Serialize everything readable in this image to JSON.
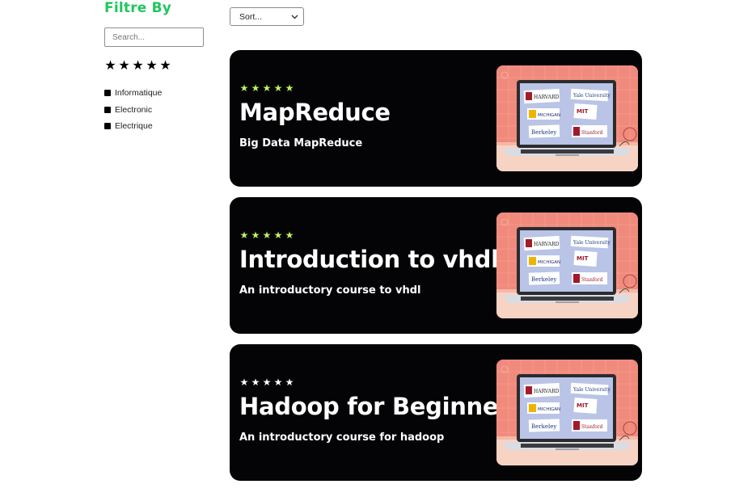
{
  "sidebar": {
    "title": "Filtre By",
    "search_placeholder": "Search...",
    "rating_filter": [
      "★",
      "★",
      "★",
      "★",
      "★"
    ],
    "categories": [
      "Informatique",
      "Electronic",
      "Electrique"
    ]
  },
  "sort": {
    "label": "Sort...",
    "icon": "chevron-down-icon"
  },
  "colors": {
    "filter_title": "#22c55e",
    "card_bg": "#040406",
    "star_green": "#bef264",
    "star_white": "#ffffff",
    "thumb_bg": "#f08a7c"
  },
  "courses": [
    {
      "rating": 5,
      "title": "MapReduce",
      "subtitle": "Big Data MapReduce",
      "star_color": "green"
    },
    {
      "rating": 5,
      "title": "Introduction to vhdl",
      "subtitle": "An introductory course to vhdl",
      "star_color": "green"
    },
    {
      "rating": 5,
      "title": "Hadoop for Beginners",
      "subtitle": "An introductory course for hadoop",
      "star_color": "white"
    }
  ],
  "thumbnail": {
    "university_labels": [
      "HARVARD",
      "Yale University",
      "MICHIGAN",
      "MIT",
      "Berkeley",
      "Stanford"
    ]
  }
}
